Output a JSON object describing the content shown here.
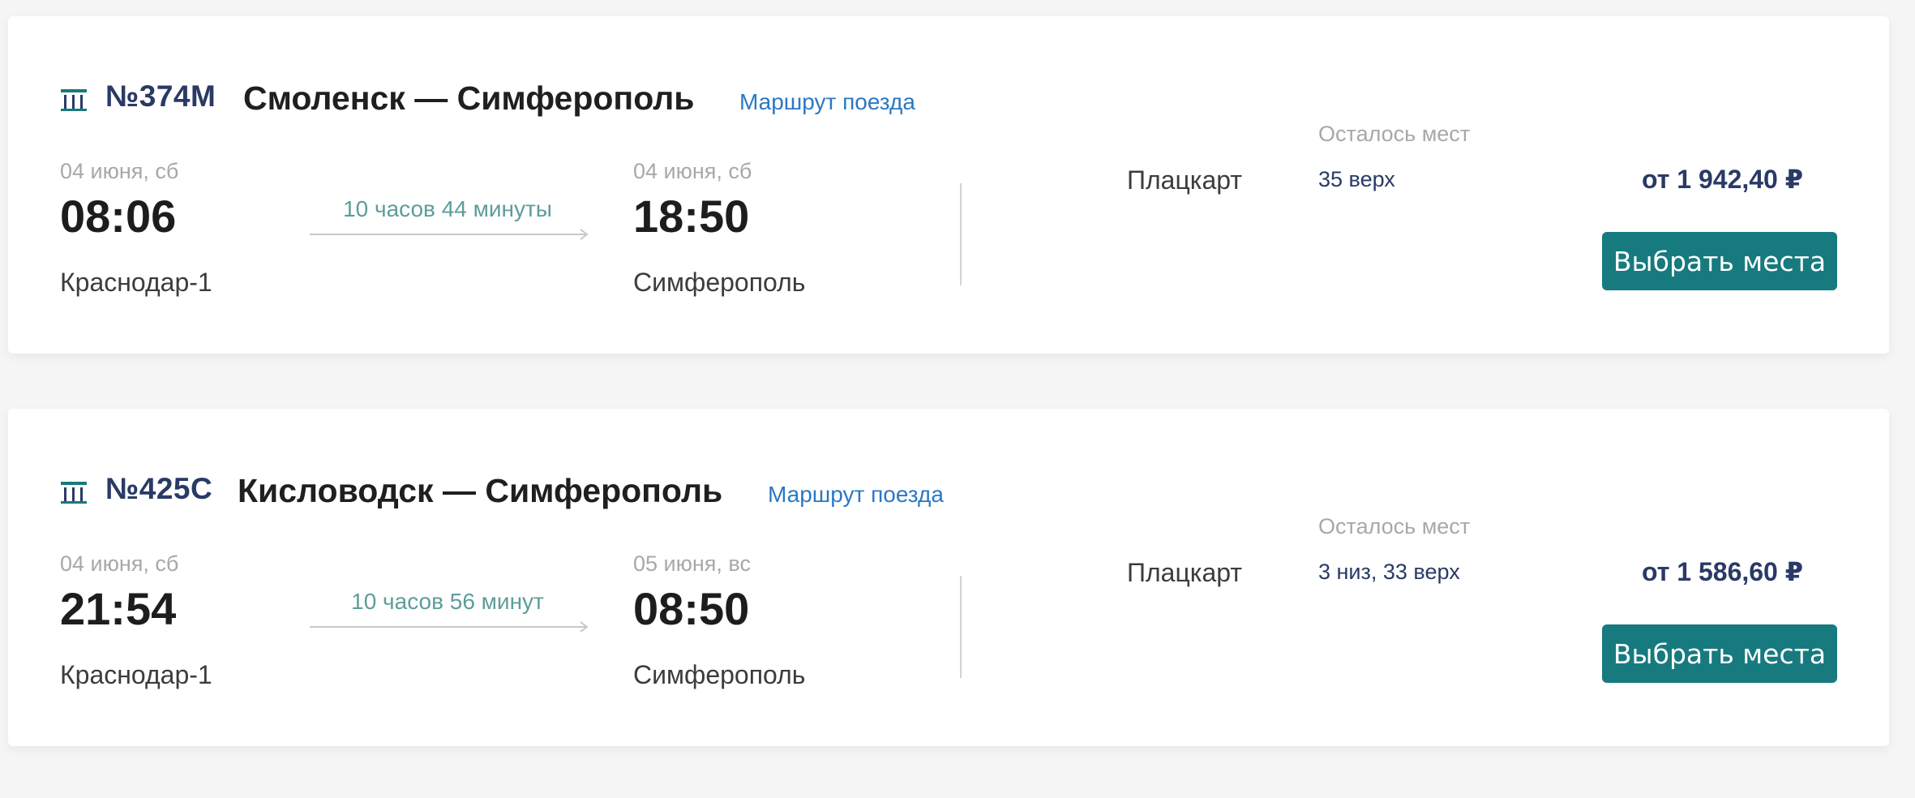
{
  "trains": [
    {
      "number": "№374М",
      "route": "Смоленск — Симферополь",
      "route_link": "Маршрут поезда",
      "departure": {
        "date": "04 июня, сб",
        "time": "08:06",
        "station": "Краснодар-1"
      },
      "duration": "10 часов 44 минуты",
      "arrival": {
        "date": "04 июня, сб",
        "time": "18:50",
        "station": "Симферополь"
      },
      "car_type": "Плацкарт",
      "seats_label": "Осталось мест",
      "seats": "35 верх",
      "price": "от 1 942,40 ₽",
      "button": "Выбрать места"
    },
    {
      "number": "№425С",
      "route": "Кисловодск — Симферополь",
      "route_link": "Маршрут поезда",
      "departure": {
        "date": "04 июня, сб",
        "time": "21:54",
        "station": "Краснодар-1"
      },
      "duration": "10 часов 56 минут",
      "arrival": {
        "date": "05 июня, вс",
        "time": "08:50",
        "station": "Симферополь"
      },
      "car_type": "Плацкарт",
      "seats_label": "Осталось мест",
      "seats": "3 низ, 33 верх",
      "price": "от 1 586,60 ₽",
      "button": "Выбрать места"
    }
  ],
  "icons": {
    "train": "train-icon",
    "arrow": "arrow-right-icon"
  },
  "colors": {
    "accent": "#177a7e",
    "link": "#2b78c5",
    "train_number": "#2a3a66",
    "duration": "#5d9d9a"
  }
}
